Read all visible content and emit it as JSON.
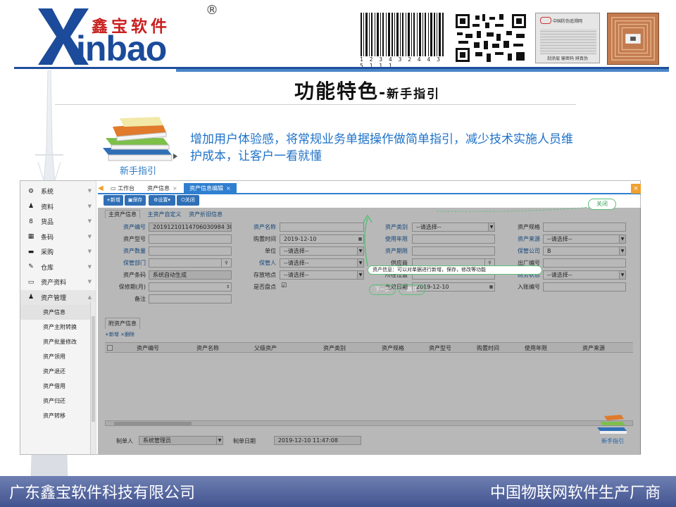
{
  "brand": {
    "name_cn": "鑫宝软件",
    "name_en": "inbao",
    "registered": "®",
    "barcode_number": "1 2 3 4 3 2 4 4 3 5 1 1 1",
    "label_top": "中国防伪追溯网",
    "label_bottom": "刮涂层 输密码 辨真伪"
  },
  "page": {
    "title": "功能特色",
    "title_sep": "-",
    "subtitle": "新手指引"
  },
  "feature": {
    "icon_label": "新手指引",
    "description": "增加用户体验感，将常规业务单据操作做简单指引，减少技术实施人员维护成本，让客户一看就懂"
  },
  "app": {
    "sidebar": [
      {
        "icon": "gear-icon",
        "glyph": "⚙",
        "label": "系统"
      },
      {
        "icon": "user-icon",
        "glyph": "👤",
        "label": "资料"
      },
      {
        "icon": "box-icon",
        "glyph": "8",
        "label": "货品"
      },
      {
        "icon": "barcode-icon",
        "glyph": "▦",
        "label": "条码"
      },
      {
        "icon": "purchase-icon",
        "glyph": "▬",
        "label": "采购"
      },
      {
        "icon": "edit-icon",
        "glyph": "✎",
        "label": "仓库"
      },
      {
        "icon": "monitor-icon",
        "glyph": "▭",
        "label": "资产资料"
      },
      {
        "icon": "user-icon",
        "glyph": "👤",
        "label": "资产管理"
      }
    ],
    "sidebar_sub": [
      "资产信息",
      "资产主附转换",
      "资产批量修改",
      "资产领用",
      "资产退还",
      "资产借用",
      "资产归还",
      "资产转移"
    ],
    "tabs": {
      "workbench": "工作台",
      "info": "资产信息",
      "edit": "资产信息编辑"
    },
    "toolbar": {
      "new": "+新增",
      "save": "保存",
      "settings": "设置",
      "close": "关闭"
    },
    "form_tabs": [
      "主资产信息",
      "主资产自定义",
      "资产折旧信息"
    ],
    "fields": {
      "asset_code_label": "资产编号",
      "asset_code_value": "20191210114706030984 38M",
      "asset_name_label": "资产名称",
      "asset_category_label": "资产类别",
      "asset_category_value": "--请选择--",
      "asset_spec_label": "资产规格",
      "asset_model_label": "资产型号",
      "purchase_time_label": "购置时间",
      "purchase_time_value": "2019-12-10",
      "useful_years_label": "使用年限",
      "asset_source_label": "资产来源",
      "asset_source_value": "--请选择--",
      "asset_qty_label": "资产数量",
      "unit_label": "单位",
      "unit_value": "--请选择--",
      "lease_label": "资产期限",
      "custody_company_label": "保管公司",
      "custody_company_value": "B",
      "custody_dept_label": "保管部门",
      "custodian_label": "保管人",
      "custodian_value": "--请选择--",
      "supplier_label": "供应商",
      "factory_code_label": "出厂编号",
      "asset_barcode_label": "资产条码",
      "asset_barcode_value": "系统自动生成",
      "storage_label": "存放地点",
      "storage_value": "--请选择--",
      "location_label": "所在位置",
      "finance_label": "财务状态",
      "finance_value": "--请选择--",
      "warranty_label": "保修期(月)",
      "inventory_label": "是否盘点",
      "entry_date_label": "生效日期",
      "entry_date_value": "2019-12-10",
      "account_code_label": "入账编号",
      "remark_label": "备注"
    },
    "sub_section": {
      "tab": "附资产信息",
      "new": "+新增",
      "delete": "×删除",
      "columns": [
        "资产编号",
        "资产名称",
        "父级资产",
        "资产类别",
        "资产规格",
        "资产型号",
        "购置时间",
        "使用年限",
        "资产来源"
      ]
    },
    "footer": {
      "maker_label": "制单人",
      "maker_value": "系统管理员",
      "date_label": "制单日期",
      "date_value": "2019-12-10 11:47:08"
    },
    "guide": {
      "close": "关闭",
      "tip": "资产信息：可以对单据进行新增，保存，修改等功能",
      "next": "下一步",
      "skip": "跳过",
      "label": "新手指引"
    }
  },
  "banner": {
    "left": "广东鑫宝软件科技有限公司",
    "right": "中国物联网软件生产厂商"
  },
  "colors": {
    "brand_blue": "#1b4b9a",
    "brand_red": "#c8201f",
    "accent_blue": "#2f7fd0",
    "guide_green": "#5bbf7a",
    "banner": "#425490"
  }
}
